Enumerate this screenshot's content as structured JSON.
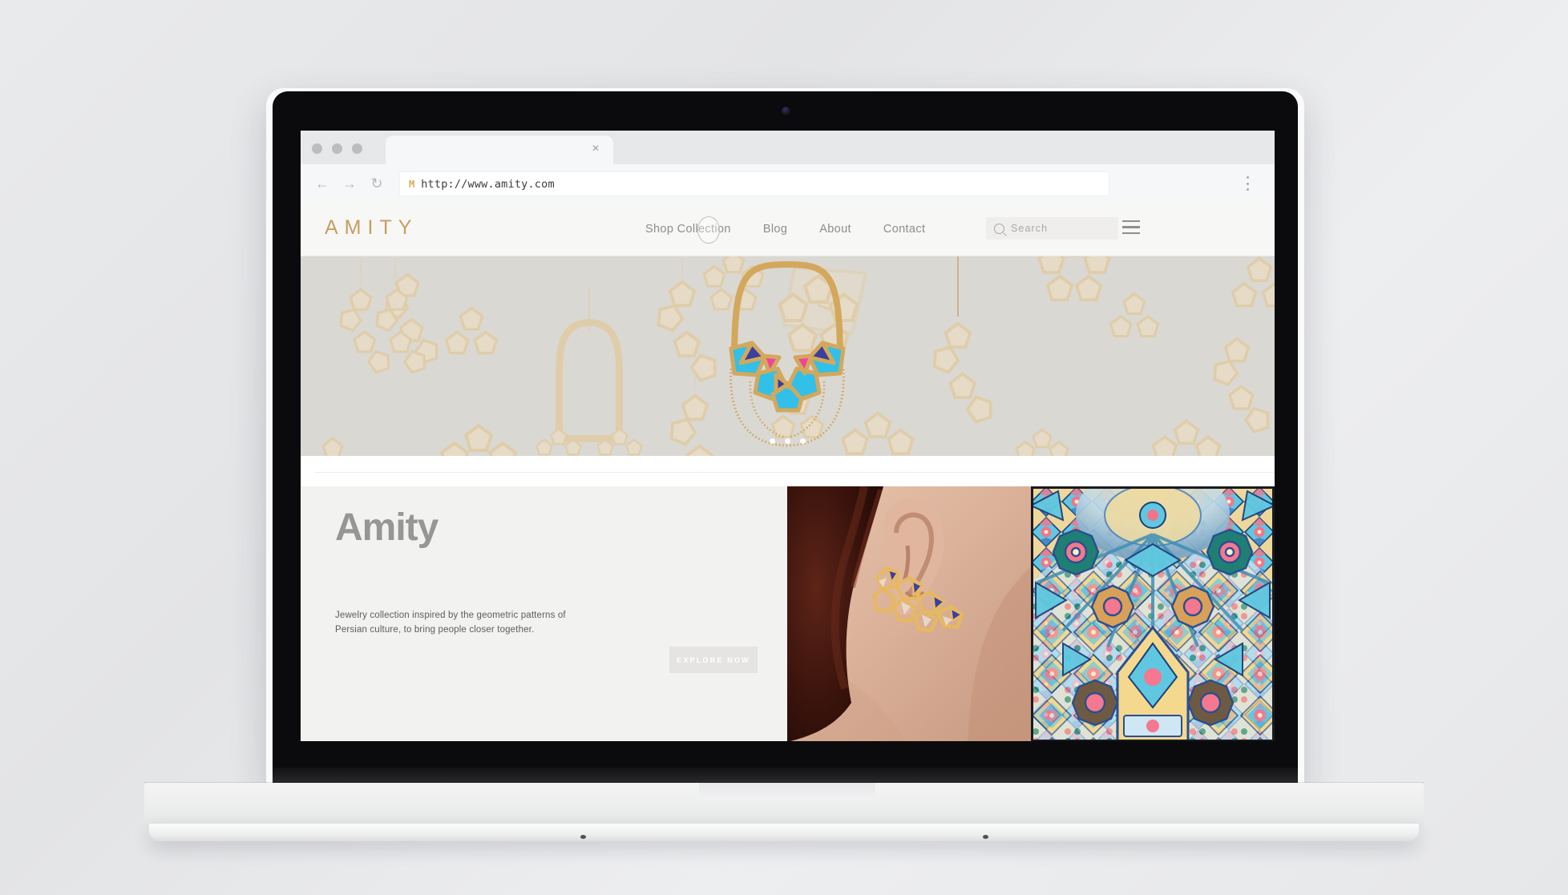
{
  "browser": {
    "tab_close_label": "×",
    "back_icon": "←",
    "forward_icon": "→",
    "reload_icon": "↻",
    "favicon_label": "M",
    "url": "http://www.amity.com"
  },
  "site": {
    "brand": "AMITY",
    "menu": [
      {
        "label": "Shop Collection"
      },
      {
        "label": "Blog"
      },
      {
        "label": "About"
      },
      {
        "label": "Contact"
      }
    ],
    "search": {
      "placeholder": "Search"
    },
    "hero": {
      "carousel_dots": 3,
      "background_color": "#dad8d3",
      "pattern_color": "#e5d9c2",
      "necklace_gold": "#d3a85c",
      "gem_cyan": "#32c0e8",
      "gem_navy": "#3b3f9e",
      "gem_pink": "#f0459a"
    },
    "content": {
      "headline": "Amity",
      "subcopy": "Jewelry collection inspired by the geometric patterns of Persian culture, to bring people closer together.",
      "cta_label": "EXPLORE NOW",
      "panel_color": "#f2f2f0",
      "cta_color": "#e5e4e2"
    }
  }
}
